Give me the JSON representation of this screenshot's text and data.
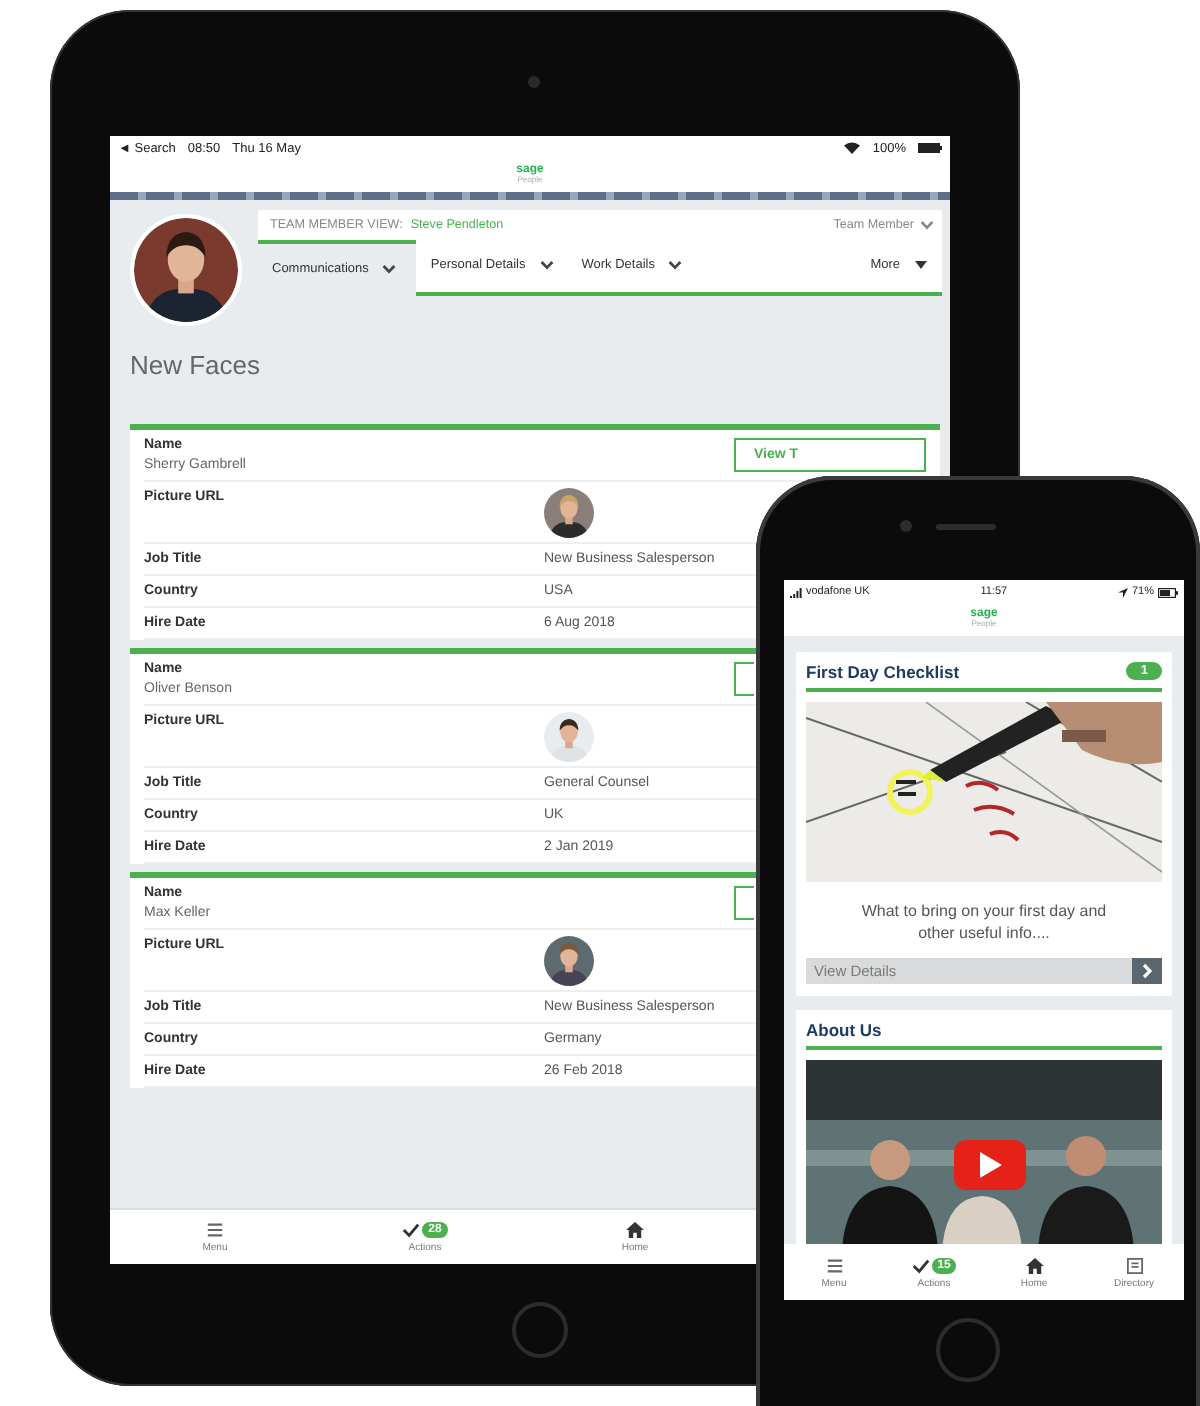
{
  "tablet": {
    "status_bar": {
      "back": "◄ Search",
      "time": "08:50",
      "date": "Thu 16 May",
      "battery": "100%"
    },
    "logo": {
      "brand": "sage",
      "product": "People"
    },
    "profile": {
      "view_label": "TEAM MEMBER VIEW:",
      "name": "Steve Pendleton",
      "role_menu": "Team Member"
    },
    "tabs": [
      {
        "label": "Communications",
        "selected": true,
        "kind": "chevron"
      },
      {
        "label": "Personal Details",
        "selected": false,
        "kind": "chevron"
      },
      {
        "label": "Work Details",
        "selected": false,
        "kind": "chevron"
      },
      {
        "label": "More",
        "selected": false,
        "kind": "caret"
      }
    ],
    "page_title": "New Faces",
    "cards": [
      {
        "name_label": "Name",
        "name": "Sherry Gambrell",
        "button": "View T",
        "fields": [
          {
            "kind": "picture",
            "label": "Picture URL"
          },
          {
            "kind": "text",
            "label": "Job Title",
            "value": "New Business Salesperson"
          },
          {
            "kind": "text",
            "label": "Country",
            "value": "USA"
          },
          {
            "kind": "text",
            "label": "Hire Date",
            "value": "6 Aug 2018"
          }
        ]
      },
      {
        "name_label": "Name",
        "name": "Oliver Benson",
        "fields": [
          {
            "kind": "picture",
            "label": "Picture URL"
          },
          {
            "kind": "text",
            "label": "Job Title",
            "value": "General Counsel"
          },
          {
            "kind": "text",
            "label": "Country",
            "value": "UK"
          },
          {
            "kind": "text",
            "label": "Hire Date",
            "value": "2 Jan 2019"
          }
        ]
      },
      {
        "name_label": "Name",
        "name": "Max Keller",
        "fields": [
          {
            "kind": "picture",
            "label": "Picture URL"
          },
          {
            "kind": "text",
            "label": "Job Title",
            "value": "New Business Salesperson"
          },
          {
            "kind": "text",
            "label": "Country",
            "value": "Germany"
          },
          {
            "kind": "text",
            "label": "Hire Date",
            "value": "26 Feb 2018"
          }
        ]
      }
    ],
    "nav": [
      {
        "label": "Menu",
        "kind": "menu"
      },
      {
        "label": "Actions",
        "kind": "check",
        "badge": "28"
      },
      {
        "label": "Home",
        "kind": "home"
      }
    ]
  },
  "phone": {
    "status_bar": {
      "carrier": "vodafone UK",
      "time": "11:57",
      "battery": "71%"
    },
    "logo": {
      "brand": "sage",
      "product": "People"
    },
    "checklist_card": {
      "title": "First Day Checklist",
      "badge": "1",
      "description": "What to bring on your first day and other useful info....",
      "link": "View Details"
    },
    "about_card": {
      "title": "About Us"
    },
    "nav": [
      {
        "label": "Menu",
        "kind": "menu"
      },
      {
        "label": "Actions",
        "kind": "check",
        "badge": "15"
      },
      {
        "label": "Home",
        "kind": "home"
      },
      {
        "label": "Directory",
        "kind": "directory"
      }
    ]
  }
}
